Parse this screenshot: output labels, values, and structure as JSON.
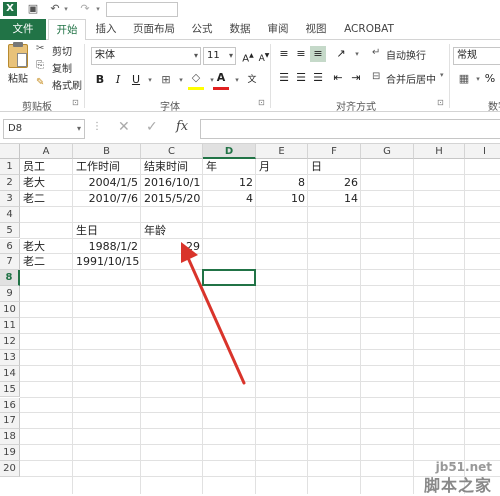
{
  "quick_access": {
    "undo_label": "↶",
    "redo_label": "↷"
  },
  "tabs": [
    "文件",
    "开始",
    "插入",
    "页面布局",
    "公式",
    "数据",
    "审阅",
    "视图",
    "ACROBAT"
  ],
  "ribbon": {
    "clipboard": {
      "paste": "粘贴",
      "cut": "剪切",
      "copy": "复制",
      "format_painter": "格式刷",
      "group": "剪贴板"
    },
    "font": {
      "name": "宋体",
      "size": "11",
      "group": "字体"
    },
    "alignment": {
      "wrap_text": "自动换行",
      "merge_center": "合并后居中",
      "group": "对齐方式"
    },
    "number": {
      "format": "常规",
      "group_partial": "数字"
    }
  },
  "formula_bar": {
    "name_box": "D8",
    "fx": "fx"
  },
  "grid": {
    "columns": [
      "A",
      "B",
      "C",
      "D",
      "E",
      "F",
      "G",
      "H",
      "I"
    ],
    "rows": [
      "1",
      "2",
      "3",
      "4",
      "5",
      "6",
      "7",
      "8",
      "9",
      "10",
      "11",
      "12",
      "13",
      "14",
      "15",
      "16",
      "17",
      "18",
      "19",
      "20"
    ],
    "cells": {
      "A1": "员工",
      "B1": "工作时间",
      "C1": "结束时间",
      "D1": "年",
      "E1": "月",
      "F1": "日",
      "A2": "老大",
      "B2": "2004/1/5",
      "C2": "2016/10/1",
      "D2": "12",
      "E2": "8",
      "F2": "26",
      "A3": "老二",
      "B3": "2010/7/6",
      "C3": "2015/5/20",
      "D3": "4",
      "E3": "10",
      "F3": "14",
      "B5": "生日",
      "C5": "年龄",
      "A6": "老大",
      "B6": "1988/1/2",
      "C6": "29",
      "A7": "老二",
      "B7": "1991/10/15"
    }
  },
  "watermark": {
    "site": "jb51.net",
    "brand": "脚本之家"
  },
  "colors": {
    "excel_green": "#217346",
    "annotation_arrow": "#d9342b"
  }
}
